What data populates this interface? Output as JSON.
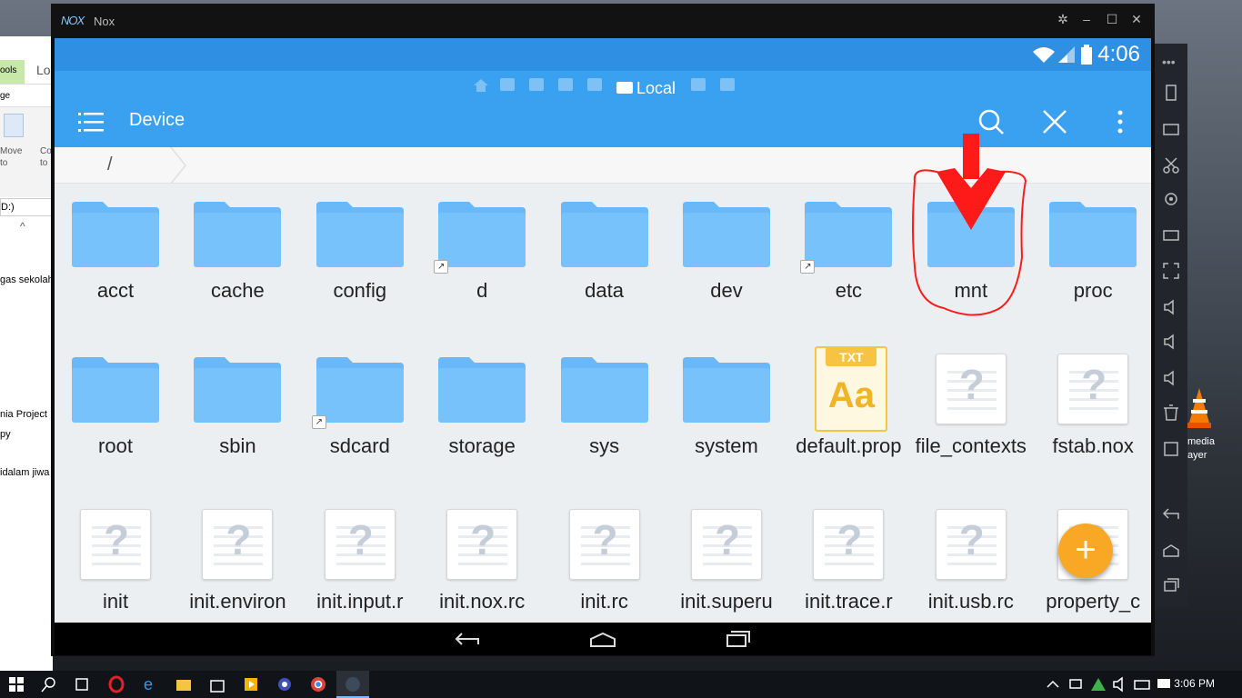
{
  "explorer": {
    "ribbon_tab": "ools",
    "title_partial": "Lo",
    "manage": "ge",
    "move_to": "Move to",
    "copy_to": "Co to",
    "drive": "D:)",
    "files": [
      "gas sekolah",
      "nia Project",
      "py",
      "idalam jiwa"
    ]
  },
  "vlc": {
    "label_line1": "media",
    "label_line2": "ayer"
  },
  "nox": {
    "logo": "NOX",
    "app_name": "Nox",
    "time": "4:06",
    "location_tab": "Local",
    "title": "Device",
    "path": "/",
    "items": [
      {
        "name": "acct",
        "type": "folder",
        "link": false
      },
      {
        "name": "cache",
        "type": "folder",
        "link": false
      },
      {
        "name": "config",
        "type": "folder",
        "link": false
      },
      {
        "name": "d",
        "type": "folder",
        "link": true
      },
      {
        "name": "data",
        "type": "folder",
        "link": false
      },
      {
        "name": "dev",
        "type": "folder",
        "link": false
      },
      {
        "name": "etc",
        "type": "folder",
        "link": true
      },
      {
        "name": "mnt",
        "type": "folder",
        "link": false
      },
      {
        "name": "proc",
        "type": "folder",
        "link": false
      },
      {
        "name": "root",
        "type": "folder",
        "link": false
      },
      {
        "name": "sbin",
        "type": "folder",
        "link": false
      },
      {
        "name": "sdcard",
        "type": "folder",
        "link": true
      },
      {
        "name": "storage",
        "type": "folder",
        "link": false
      },
      {
        "name": "sys",
        "type": "folder",
        "link": false
      },
      {
        "name": "system",
        "type": "folder",
        "link": false
      },
      {
        "name": "default.prop",
        "type": "txt",
        "link": false
      },
      {
        "name": "file_contexts",
        "type": "unknown",
        "link": false
      },
      {
        "name": "fstab.nox",
        "type": "unknown",
        "link": false
      },
      {
        "name": "init",
        "type": "unknown",
        "link": false
      },
      {
        "name": "init.environ",
        "type": "unknown",
        "link": false
      },
      {
        "name": "init.input.r",
        "type": "unknown",
        "link": false
      },
      {
        "name": "init.nox.rc",
        "type": "unknown",
        "link": false
      },
      {
        "name": "init.rc",
        "type": "unknown",
        "link": false
      },
      {
        "name": "init.superu",
        "type": "unknown",
        "link": false
      },
      {
        "name": "init.trace.r",
        "type": "unknown",
        "link": false
      },
      {
        "name": "init.usb.rc",
        "type": "unknown",
        "link": false
      },
      {
        "name": "property_c",
        "type": "unknown",
        "link": false
      }
    ],
    "txt_badge": "TXT",
    "txt_glyph": "Aa",
    "fab": "+"
  },
  "taskbar": {
    "time": "3:06 PM"
  },
  "colors": {
    "accent": "#3aa0f0",
    "statusbar": "#2f8fe3",
    "folder": "#6ab8f7",
    "fab": "#f9a825",
    "annotation": "#ff0000"
  }
}
